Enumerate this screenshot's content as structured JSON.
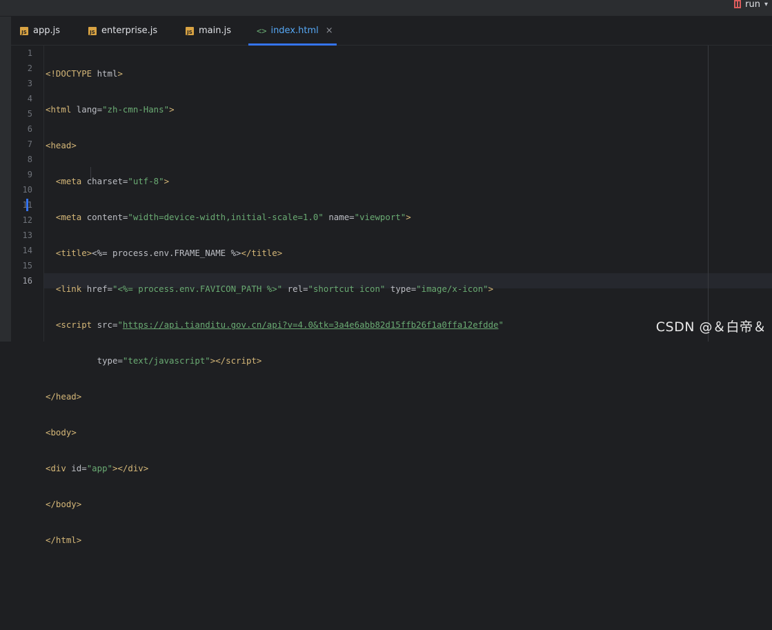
{
  "topbar": {
    "run_label": "run",
    "run_icon": "run-config-icon",
    "chevron": "▾"
  },
  "tabs": [
    {
      "label": "app.js",
      "icon": "JS",
      "active": false
    },
    {
      "label": "enterprise.js",
      "icon": "JS",
      "active": false
    },
    {
      "label": "main.js",
      "icon": "JS",
      "active": false
    },
    {
      "label": "index.html",
      "icon": "<>",
      "active": true,
      "close": "×"
    }
  ],
  "gutter": {
    "line_numbers": [
      "1",
      "2",
      "3",
      "4",
      "5",
      "6",
      "7",
      "8",
      "9",
      "10",
      "11",
      "12",
      "13",
      "14",
      "15",
      "16"
    ]
  },
  "code": {
    "l1": {
      "lt": "<!",
      "tag": "DOCTYPE",
      "rest": " html",
      "gt": ">"
    },
    "l2": {
      "open": "<html",
      "attr": " lang=",
      "val": "\"zh-cmn-Hans\"",
      "close": ">"
    },
    "l3": {
      "open": "<head",
      "close": ">"
    },
    "l4": {
      "indent": "  ",
      "open": "<meta",
      "attr": " charset=",
      "val": "\"utf-8\"",
      "close": ">"
    },
    "l5": {
      "indent": "  ",
      "open": "<meta",
      "attr1": " content=",
      "val1": "\"width=device-width,initial-scale=1.0\"",
      "attr2": " name=",
      "val2": "\"viewport\"",
      "close": ">"
    },
    "l6": {
      "indent": "  ",
      "open": "<title",
      "gt": ">",
      "text": "<%= process.env.FRAME_NAME %>",
      "closetag": "</title",
      "close": ">"
    },
    "l7": {
      "indent": "  ",
      "open": "<link",
      "attr1": " href=",
      "val1": "\"<%= process.env.FAVICON_PATH %>\"",
      "attr2": " rel=",
      "val2": "\"shortcut icon\"",
      "attr3": " type=",
      "val3": "\"image/x-icon\"",
      "close": ">"
    },
    "l8": {
      "indent": "  ",
      "open": "<script",
      "attr": " src=",
      "q1": "\"",
      "url": "https://api.tianditu.gov.cn/api?v=4.0&tk=3a4e6abb82d15ffb26f1a0ffa12efdde",
      "q2": "\""
    },
    "l9": {
      "indent": "          ",
      "attr": "type=",
      "val": "\"text/javascript\"",
      "gt": ">",
      "closetag": "</script",
      "close": ">"
    },
    "l10": {
      "open": "</head",
      "close": ">"
    },
    "l11": {
      "open": "<body",
      "close": ">"
    },
    "l12": {
      "open": "<div",
      "attr": " id=",
      "val": "\"app\"",
      "gt": ">",
      "closetag": "</div",
      "close": ">"
    },
    "l13": {
      "open": "</body",
      "close": ">"
    },
    "l14": {
      "open": "</html",
      "close": ">"
    }
  },
  "watermark": "CSDN @＆白帝＆",
  "colors": {
    "tag": "#d5b778",
    "string": "#6aab73",
    "text": "#bcbec4",
    "accent": "#3574f0",
    "background": "#1e1f22"
  }
}
